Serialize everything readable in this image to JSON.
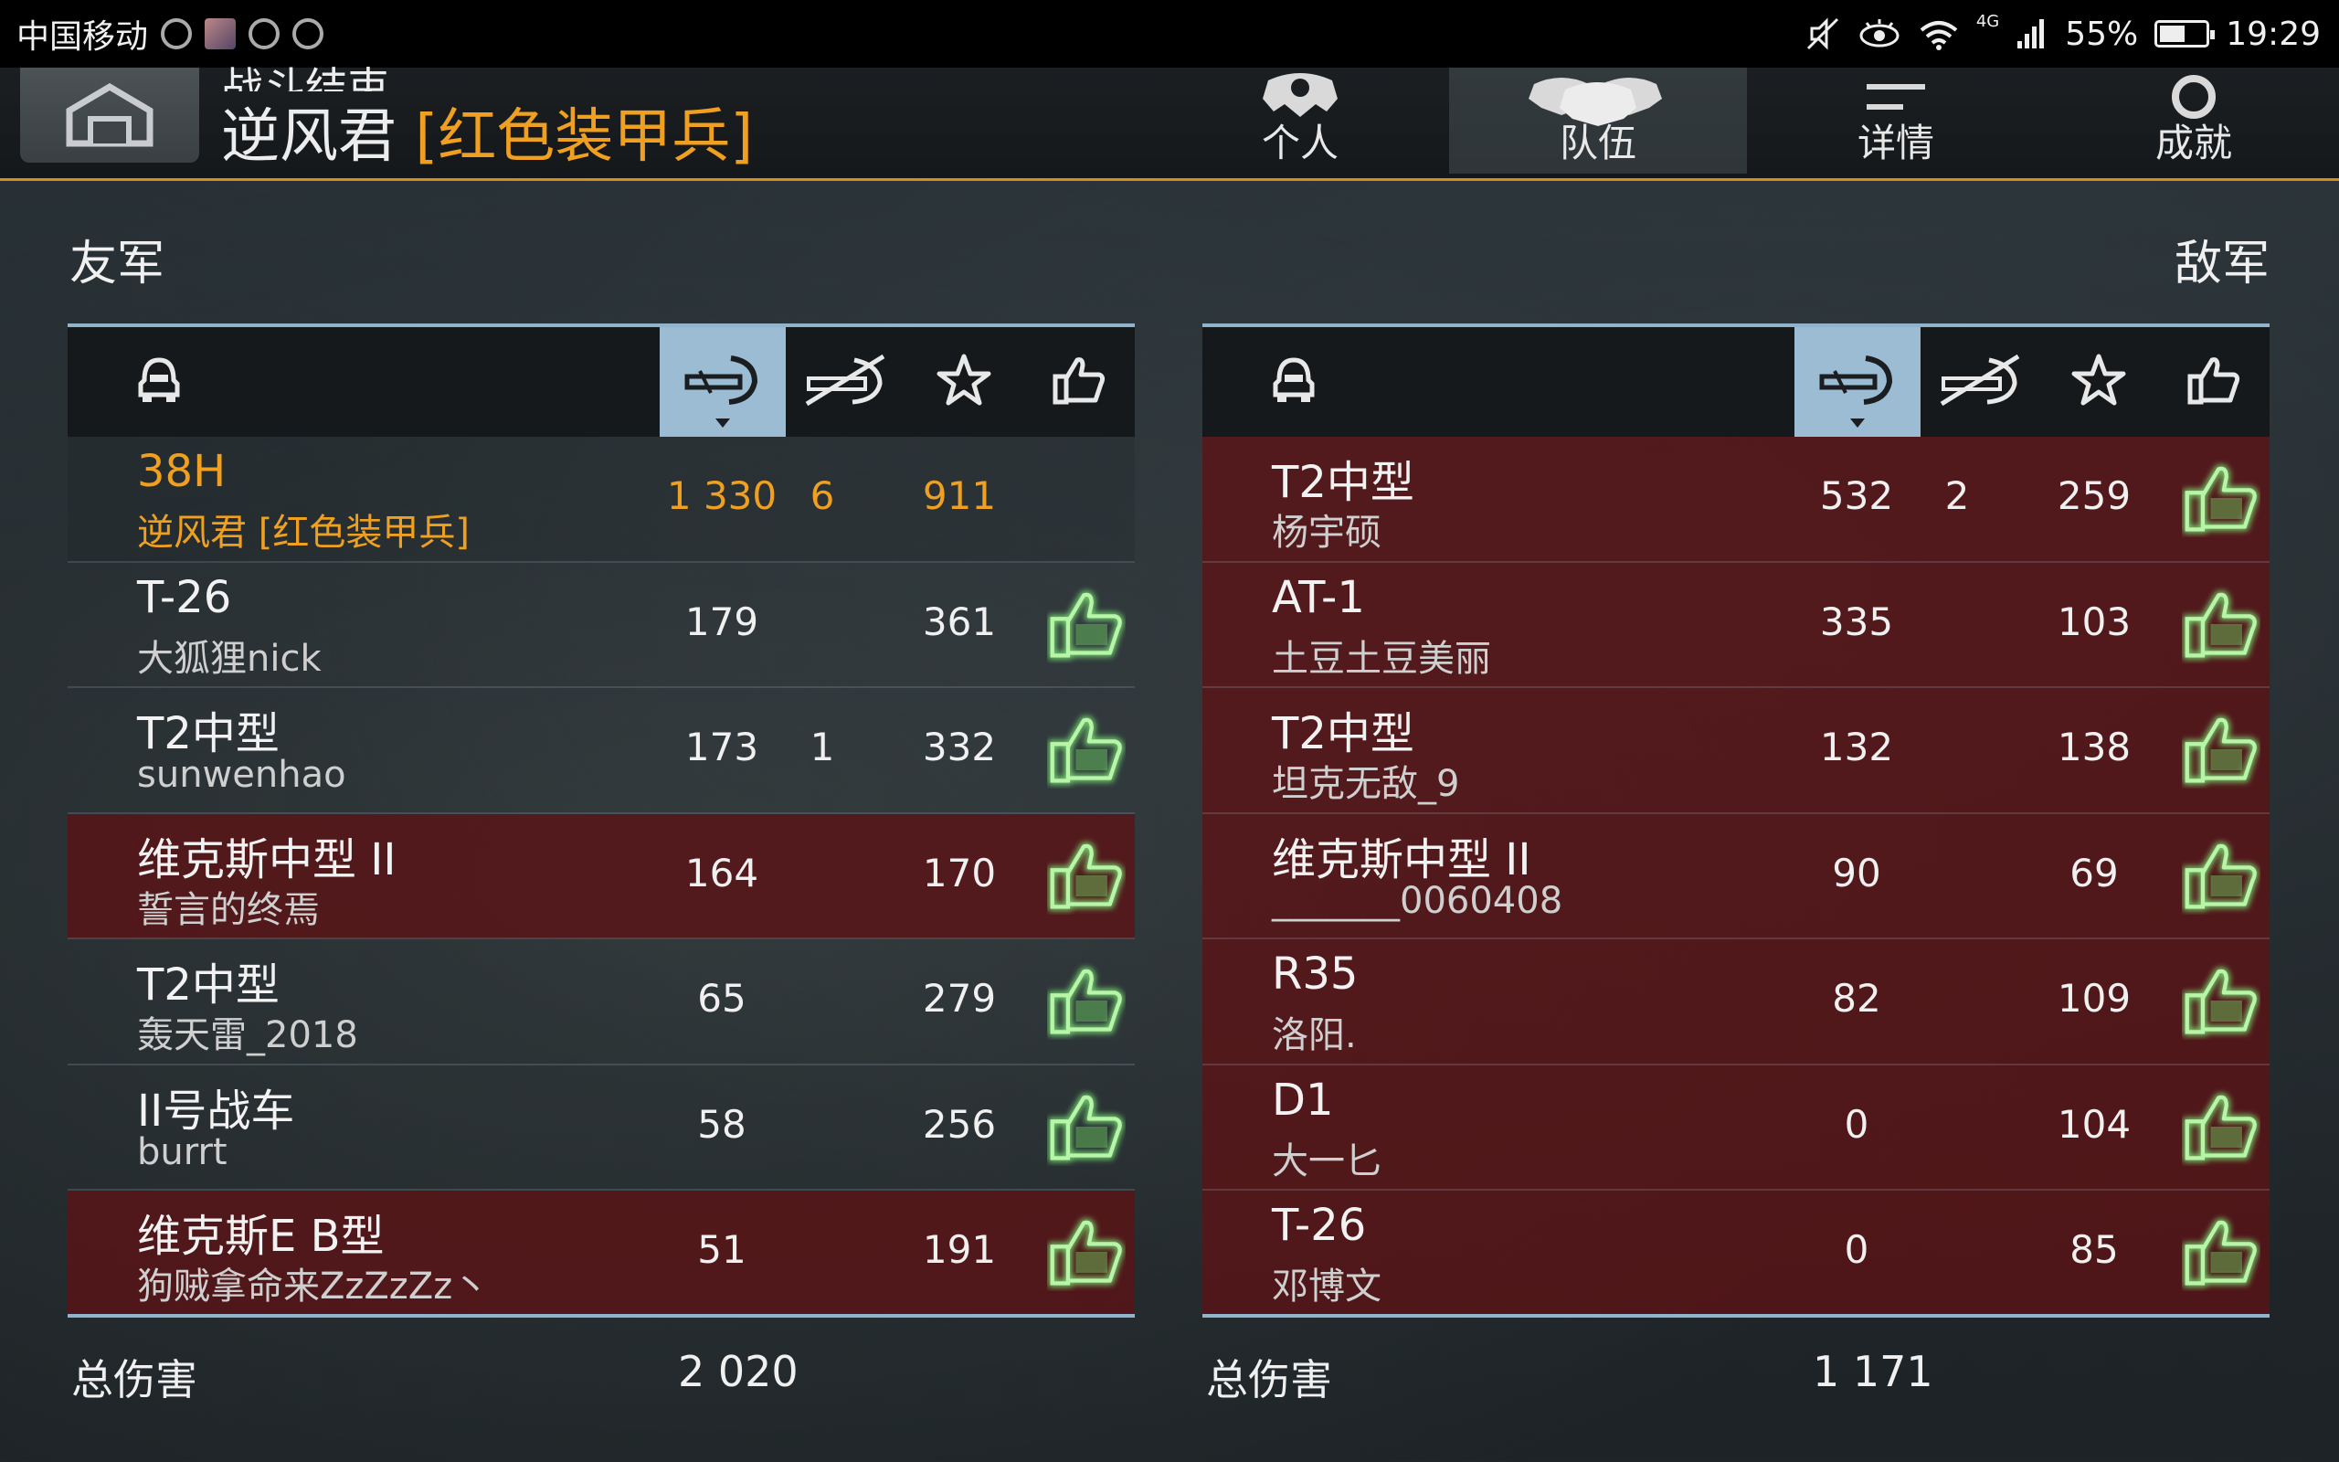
{
  "status_bar": {
    "carrier": "中国移动",
    "network": "4G",
    "battery": "55%",
    "battery_level": 0.55,
    "time": "19:29"
  },
  "header": {
    "subtitle": "战斗结束",
    "player_name": "逆风君",
    "clan_tag": "[红色装甲兵]",
    "tabs": [
      {
        "label": "个人",
        "icon": "soldier-icon",
        "active": false
      },
      {
        "label": "队伍",
        "icon": "team-icon",
        "active": true
      },
      {
        "label": "详情",
        "icon": "details-icon",
        "active": false
      },
      {
        "label": "成就",
        "icon": "medal-icon",
        "active": false
      }
    ]
  },
  "allies": {
    "label": "友军",
    "rows": [
      {
        "tank": "38H",
        "player": "逆风君 [红色装甲兵]",
        "damage": "1 330",
        "kills": "6",
        "points": "911",
        "liked": false,
        "highlight": "self"
      },
      {
        "tank": "T-26",
        "player": "大狐狸nick",
        "damage": "179",
        "kills": "",
        "points": "361",
        "liked": true,
        "highlight": "none"
      },
      {
        "tank": "T2中型",
        "player": "sunwenhao",
        "damage": "173",
        "kills": "1",
        "points": "332",
        "liked": true,
        "highlight": "none"
      },
      {
        "tank": "维克斯中型 II",
        "player": "誓言的终焉",
        "damage": "164",
        "kills": "",
        "points": "170",
        "liked": true,
        "highlight": "destroyed"
      },
      {
        "tank": "T2中型",
        "player": "轰天雷_2018",
        "damage": "65",
        "kills": "",
        "points": "279",
        "liked": true,
        "highlight": "none"
      },
      {
        "tank": "II号战车",
        "player": "burrt",
        "damage": "58",
        "kills": "",
        "points": "256",
        "liked": true,
        "highlight": "none"
      },
      {
        "tank": "维克斯E B型",
        "player": "狗贼拿命来ZzZzZz丶",
        "damage": "51",
        "kills": "",
        "points": "191",
        "liked": true,
        "highlight": "destroyed"
      }
    ],
    "total_label": "总伤害",
    "total_damage": "2 020"
  },
  "enemies": {
    "label": "敌军",
    "rows": [
      {
        "tank": "T2中型",
        "player": "杨宇硕",
        "damage": "532",
        "kills": "2",
        "points": "259",
        "liked": true,
        "highlight": "destroyed"
      },
      {
        "tank": "AT-1",
        "player": "土豆土豆美丽",
        "damage": "335",
        "kills": "",
        "points": "103",
        "liked": true,
        "highlight": "destroyed"
      },
      {
        "tank": "T2中型",
        "player": "坦克无敌_9",
        "damage": "132",
        "kills": "",
        "points": "138",
        "liked": true,
        "highlight": "destroyed"
      },
      {
        "tank": "维克斯中型 II",
        "player": "_______0060408",
        "damage": "90",
        "kills": "",
        "points": "69",
        "liked": true,
        "highlight": "destroyed"
      },
      {
        "tank": "R35",
        "player": "洛阳.",
        "damage": "82",
        "kills": "",
        "points": "109",
        "liked": true,
        "highlight": "destroyed"
      },
      {
        "tank": "D1",
        "player": "大一匕",
        "damage": "0",
        "kills": "",
        "points": "104",
        "liked": true,
        "highlight": "destroyed"
      },
      {
        "tank": "T-26",
        "player": "邓博文",
        "damage": "0",
        "kills": "",
        "points": "85",
        "liked": true,
        "highlight": "destroyed"
      }
    ],
    "total_label": "总伤害",
    "total_damage": "1 171"
  },
  "columns": [
    {
      "icon": "tank-crew-icon",
      "sorted": false
    },
    {
      "icon": "damage-icon",
      "sorted": true
    },
    {
      "icon": "kills-icon",
      "sorted": false
    },
    {
      "icon": "star-icon",
      "sorted": false
    },
    {
      "icon": "thumbs-up-icon",
      "sorted": false
    }
  ],
  "colors": {
    "accent_orange": "#f0a020",
    "sorted_column": "#9cbcd3",
    "destroyed_row": "#5a1416",
    "like_green": "#6fd36a"
  }
}
